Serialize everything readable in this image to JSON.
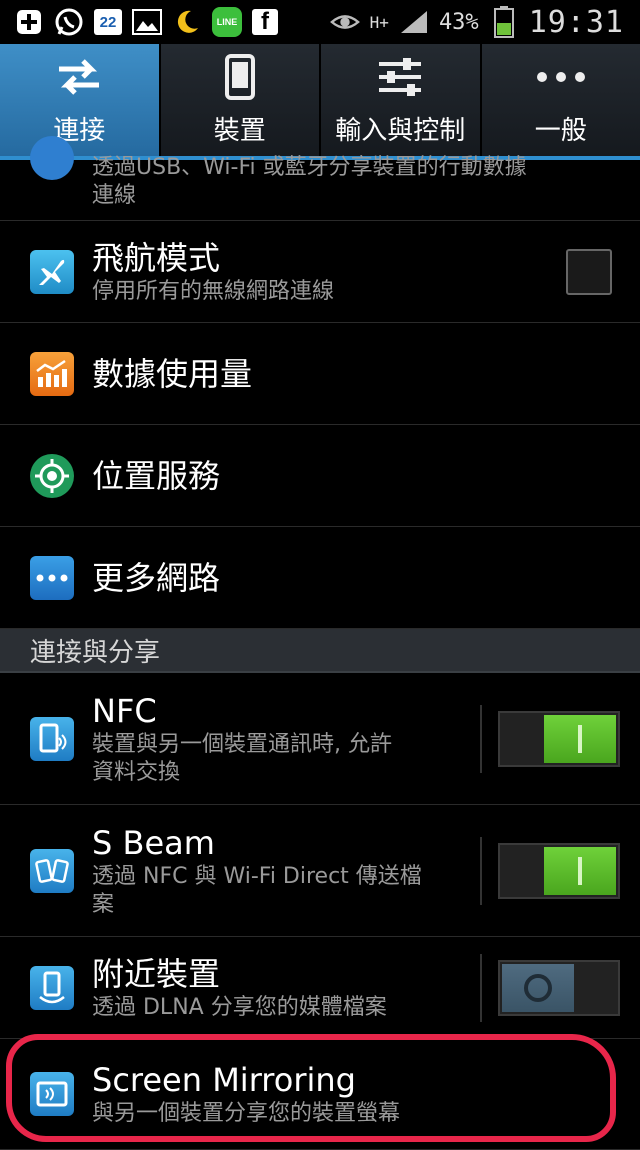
{
  "status_bar": {
    "left_icons": [
      "plus-icon",
      "whatsapp-icon",
      "calendar-icon",
      "gallery-icon",
      "moon-icon",
      "line-app-icon",
      "facebook-icon"
    ],
    "calendar_day": "22",
    "line_label": "LINE",
    "network": "H+",
    "battery_percent": "43%",
    "time": "19:31"
  },
  "tabs": [
    {
      "label": "連接",
      "icon": "swap-arrows-icon",
      "active": true
    },
    {
      "label": "裝置",
      "icon": "phone-icon",
      "active": false
    },
    {
      "label": "輸入與控制",
      "icon": "sliders-icon",
      "active": false
    },
    {
      "label": "一般",
      "icon": "more-dots-icon",
      "active": false
    }
  ],
  "rows": {
    "tethering_partial": {
      "subtitle_line1": "透過USB、Wi-Fi 或藍牙分享裝置的行動數據",
      "subtitle_line2": "連線"
    },
    "airplane": {
      "title": "飛航模式",
      "subtitle": "停用所有的無線網路連線",
      "checked": false
    },
    "data_usage": {
      "title": "數據使用量"
    },
    "location": {
      "title": "位置服務"
    },
    "more_networks": {
      "title": "更多網路"
    }
  },
  "section_header": "連接與分享",
  "share_rows": {
    "nfc": {
      "title": "NFC",
      "subtitle_line1": "裝置與另一個裝置通訊時, 允許",
      "subtitle_line2": "資料交換",
      "on": true
    },
    "sbeam": {
      "title": "S Beam",
      "subtitle_line1": "透過 NFC 與 Wi-Fi Direct 傳送檔",
      "subtitle_line2": "案",
      "on": true
    },
    "nearby": {
      "title": "附近裝置",
      "subtitle": "透過 DLNA 分享您的媒體檔案",
      "on": false
    },
    "mirroring": {
      "title": "Screen Mirroring",
      "subtitle": "與另一個裝置分享您的裝置螢幕"
    }
  },
  "colors": {
    "tab_active": "#3a86bf",
    "accent_line": "#2f8fd0",
    "switch_on": "#5cbf2a",
    "annotation": "#e8264a"
  }
}
